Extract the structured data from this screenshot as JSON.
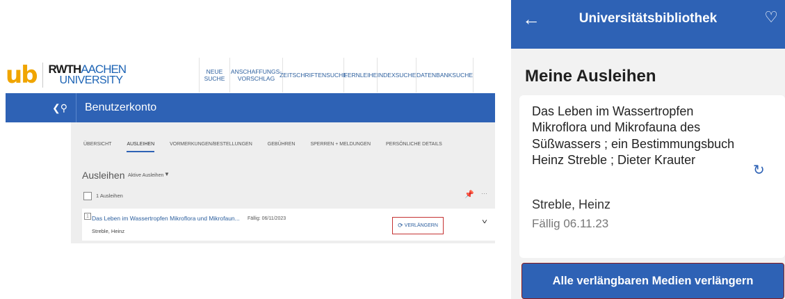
{
  "desktop": {
    "logo": {
      "ub": "ub",
      "rwth": "RWTH",
      "aachen": "AACHEN",
      "university": "UNIVERSITY"
    },
    "topnav": [
      {
        "label": "NEUE\nSUCHE"
      },
      {
        "label": "ANSCHAFFUNGS-\nVORSCHLAG"
      },
      {
        "label": "ZEITSCHRIFTENSUCHE"
      },
      {
        "label": "FERNLEIHE"
      },
      {
        "label": "INDEXSUCHE"
      },
      {
        "label": "DATENBANKSUCHE"
      }
    ],
    "header": {
      "back_icon": "back-search-icon",
      "title": "Benutzerkonto"
    },
    "tabs": [
      {
        "label": "ÜBERSICHT",
        "active": false
      },
      {
        "label": "AUSLEIHEN",
        "active": true
      },
      {
        "label": "VORMERKUNGEN/BESTELLUNGEN",
        "active": false
      },
      {
        "label": "GEBÜHREN",
        "active": false
      },
      {
        "label": "SPERREN + MELDUNGEN",
        "active": false
      },
      {
        "label": "PERSÖNLICHE DETAILS",
        "active": false
      }
    ],
    "loans": {
      "title": "Ausleihen",
      "filter": "Aktive Ausleihen",
      "count_label": "1 Ausleihen",
      "items": [
        {
          "title": "Das Leben im Wassertropfen Mikroflora und Mikrofaun...",
          "author": "Streble, Heinz",
          "due": "Fällig: 06/11/2023",
          "renew_label": "VERLÄNGERN"
        }
      ]
    },
    "colors": {
      "primary": "#2e62b5",
      "logo_orange": "#f0a500",
      "highlight_red": "#c53232"
    }
  },
  "mobile": {
    "app_bar": {
      "title": "Universitätsbibliothek",
      "back_icon": "arrow-left-icon",
      "fav_icon": "heart-icon"
    },
    "heading": "Meine Ausleihen",
    "card": {
      "title": "Das Leben im Wassertropfen Mikroflora und Mikrofauna des Süßwassers ; ein Bestimmungsbuch Heinz Streble ; Dieter Krauter",
      "author": "Streble, Heinz",
      "due": "Fällig 06.11.23",
      "renew_icon": "renew-icon"
    },
    "renew_all_label": "Alle verlängbaren Medien verlängern",
    "colors": {
      "primary": "#2e62b5",
      "background": "#f2f2f2"
    }
  }
}
